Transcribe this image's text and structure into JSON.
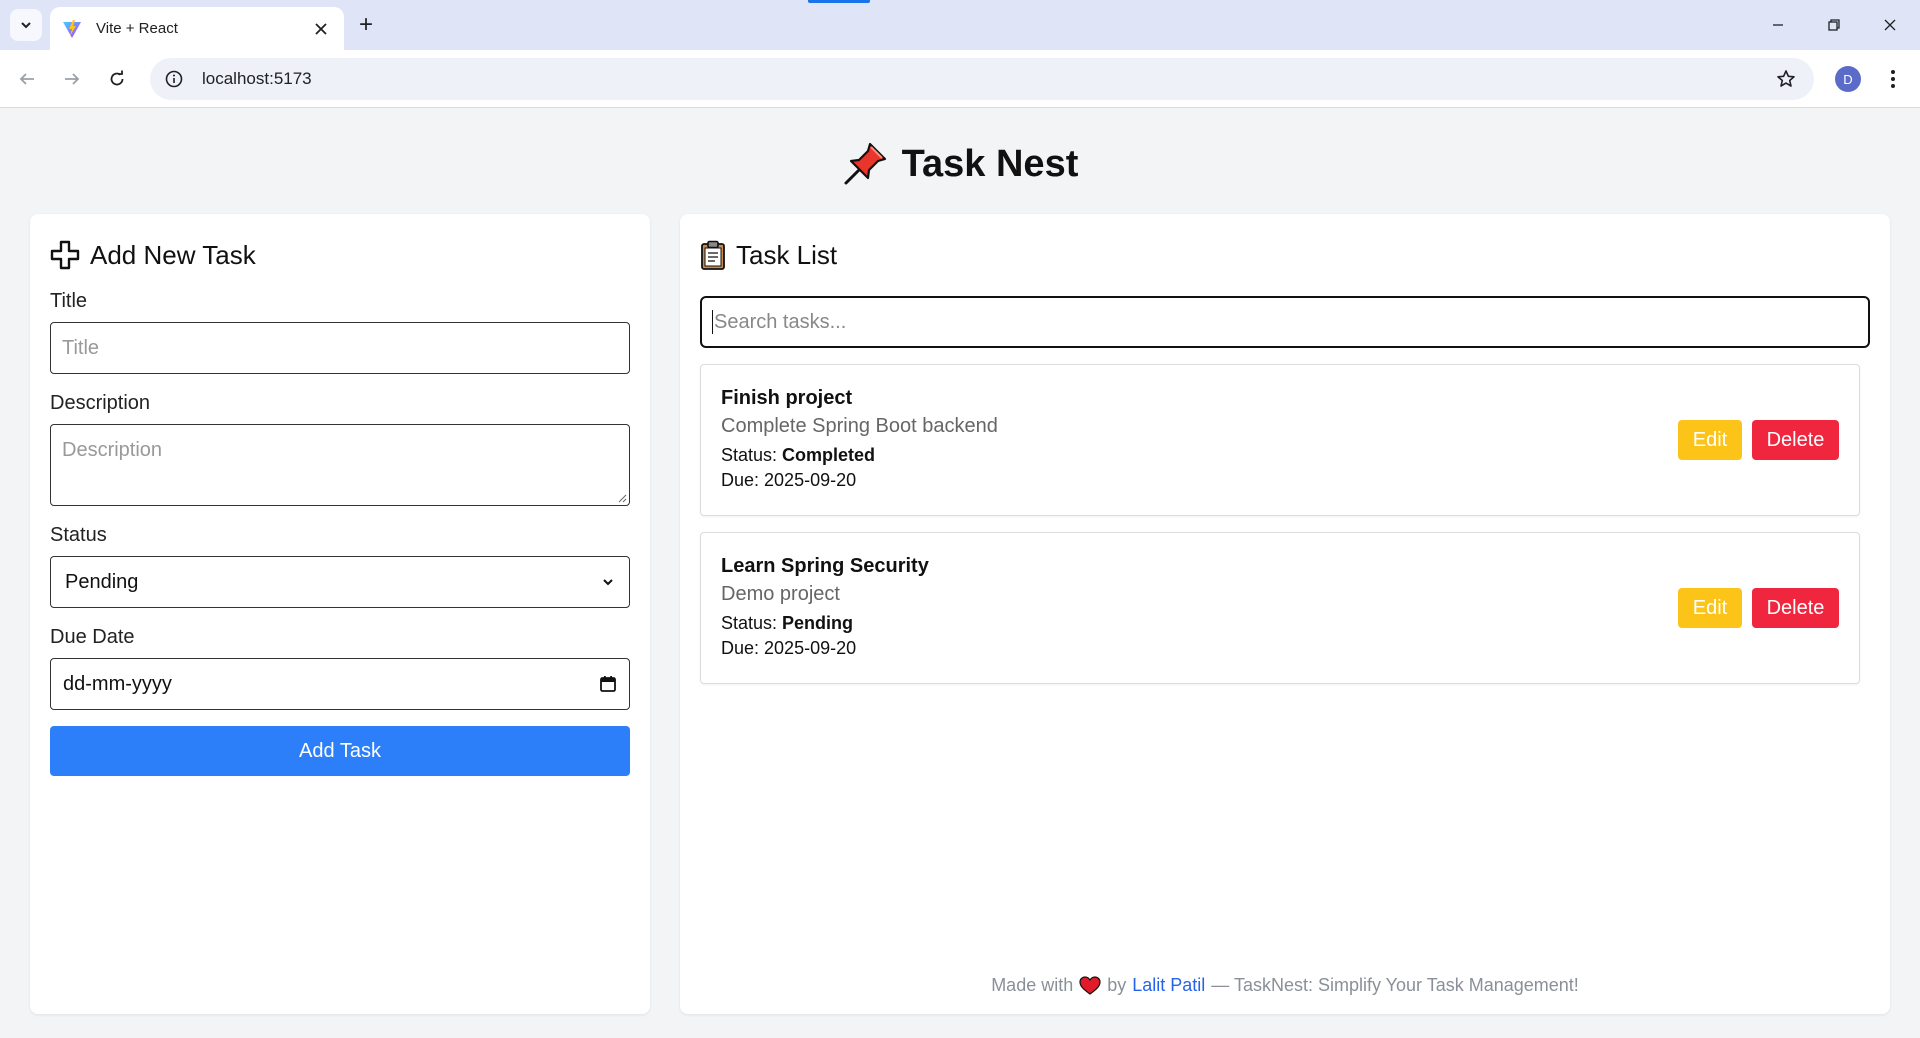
{
  "browser": {
    "tab_title": "Vite + React",
    "url": "localhost:5173",
    "profile_initial": "D",
    "new_tab_label": "+"
  },
  "app": {
    "title": "Task Nest"
  },
  "add_task": {
    "heading": "Add New Task",
    "title_label": "Title",
    "title_placeholder": "Title",
    "description_label": "Description",
    "description_placeholder": "Description",
    "status_label": "Status",
    "status_selected": "Pending",
    "due_date_label": "Due Date",
    "due_date_placeholder": "dd-mm-yyyy",
    "submit_label": "Add Task"
  },
  "task_list": {
    "heading": "Task List",
    "search_placeholder": "Search tasks...",
    "status_prefix": "Status: ",
    "due_prefix": "Due: ",
    "edit_label": "Edit",
    "delete_label": "Delete",
    "tasks": [
      {
        "title": "Finish project",
        "description": "Complete Spring Boot backend",
        "status": "Completed",
        "due": "2025-09-20"
      },
      {
        "title": "Learn Spring Security",
        "description": "Demo project",
        "status": "Pending",
        "due": "2025-09-20"
      }
    ]
  },
  "footer": {
    "made_with": "Made with",
    "by": "by",
    "author": "Lalit Patil",
    "tagline": "— TaskNest: Simplify Your Task Management!"
  },
  "colors": {
    "primary": "#2d7ff9",
    "edit": "#fcc419",
    "delete": "#f0263e",
    "background": "#f3f4f6",
    "link": "#2563eb"
  }
}
